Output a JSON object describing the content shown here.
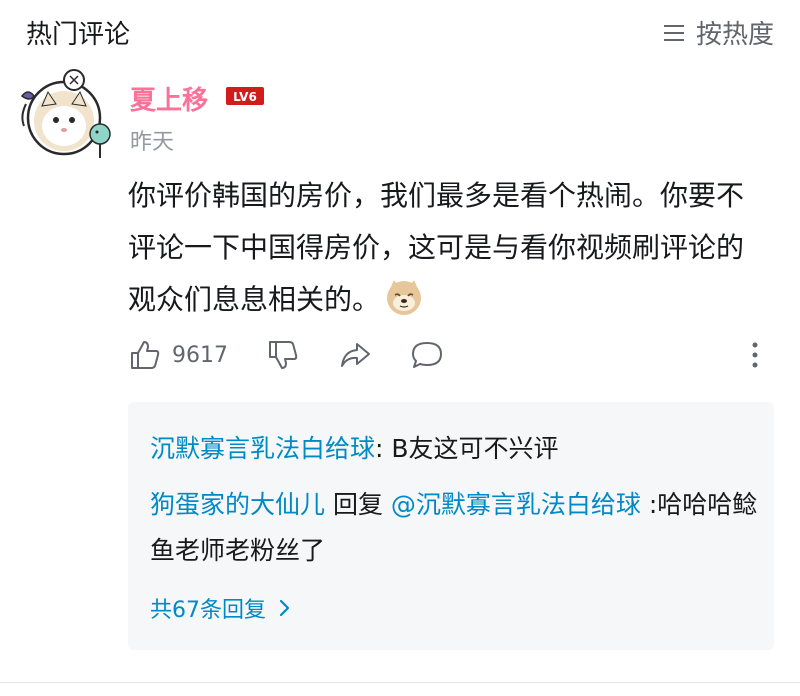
{
  "header": {
    "title": "热门评论",
    "sort_label": "按热度"
  },
  "comment": {
    "username": "夏上移",
    "level": "LV6",
    "time": "昨天",
    "text": "你评价韩国的房价，我们最多是看个热闹。你要不评论一下中国得房价，这可是与看你视频刷评论的观众们息息相关的。",
    "like_count": "9617"
  },
  "replies": [
    {
      "user": "沉默寡言乳法白给球",
      "sep": ": ",
      "text": "B友这可不兴评"
    },
    {
      "user": "狗蛋家的大仙儿",
      "reply_word": " 回复 ",
      "target": "@沉默寡言乳法白给球",
      "text": " :哈哈哈鲶鱼老师老粉丝了"
    }
  ],
  "more_replies": "共67条回复",
  "colors": {
    "username": "#fb7299",
    "link": "#008ac5",
    "level_badge": "#d21c1c",
    "reply_bg": "#f6f7f8"
  },
  "icons": [
    "sort-lines-icon",
    "thumb-up-icon",
    "thumb-down-icon",
    "share-icon",
    "comment-icon",
    "more-vertical-icon",
    "chevron-right-icon"
  ]
}
